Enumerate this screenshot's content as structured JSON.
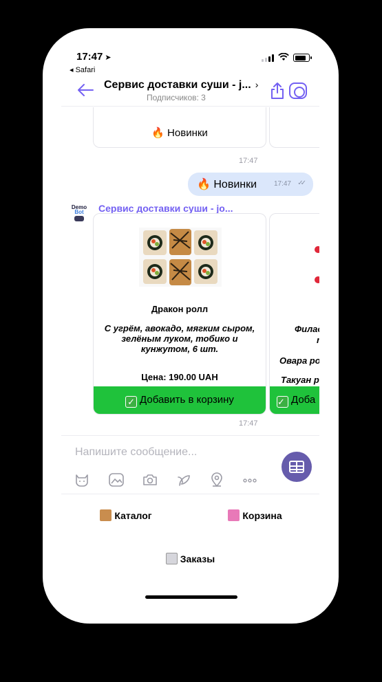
{
  "status_bar": {
    "time": "17:47",
    "location_arrow": "➤",
    "back_app": "◂ Safari",
    "battery_icon": "battery-icon",
    "wifi_icon": "wifi-icon"
  },
  "header": {
    "title": "Сервис доставки суши - j...",
    "chevron": "›",
    "subscribers": "Подписчиков: 3",
    "accent_color": "#7360f2"
  },
  "messages": {
    "prev_card_label": "🔥 Новинки",
    "prev_card_time": "17:47",
    "outgoing_text": "🔥 Новинки",
    "outgoing_time": "17:47",
    "outgoing_checks": "✓✓",
    "avatar_line1": "Demo",
    "avatar_line2": "Bot",
    "sender_name": "Сервис доставки суши - jo...",
    "carousel_time": "17:47"
  },
  "product": {
    "name": "Дракон ролл",
    "description": "С угрём, авокадо, мягким сыром, зелёным луком, тобико и кунжутом, 6 шт.",
    "price": "Цена: 190.00 UAH",
    "add_button": "Добавить в корзину",
    "button_color": "#1fc23b"
  },
  "product2": {
    "line1": "Филад",
    "line2": "т",
    "line3": "Овара рол",
    "line4": "Такуан ро",
    "add_button": "Доба"
  },
  "composer": {
    "placeholder": "Напишите сообщение...",
    "toolbar_icons": [
      "sticker-icon",
      "gallery-icon",
      "camera-icon",
      "doodle-icon",
      "location-icon",
      "more-icon"
    ]
  },
  "keyboard": {
    "catalog": "Каталог",
    "cart": "Корзина",
    "orders": "Заказы"
  }
}
